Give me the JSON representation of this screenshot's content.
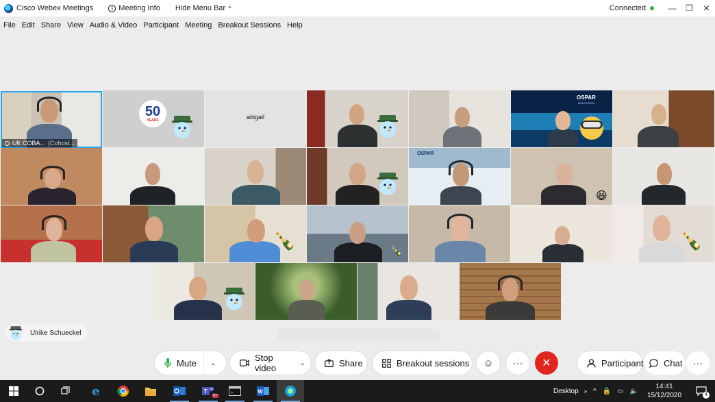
{
  "titlebar": {
    "app_name": "Cisco Webex Meetings",
    "meeting_info": "Meeting Info",
    "hide_menu_bar": "Hide Menu Bar",
    "status": "Connected",
    "status_color": "#2cb34a"
  },
  "menubar": {
    "items": [
      "File",
      "Edit",
      "Share",
      "View",
      "Audio & Video",
      "Participant",
      "Meeting",
      "Breakout Sessions",
      "Help"
    ]
  },
  "grid": {
    "active_tile_name": "UK COBA...",
    "active_tile_role": "(Cohost...",
    "abigail_label": "abigail",
    "logo_50": "50",
    "logo_50_sub": "YEARS",
    "ospar_label": "OSPAR",
    "ospar_sub": "MINISTERIAL"
  },
  "floating": {
    "name": "Ulrike Schueckel"
  },
  "controls": {
    "mute": "Mute",
    "stop_video": "Stop video",
    "share": "Share",
    "breakout": "Breakout sessions",
    "participants": "Participants",
    "chat": "Chat",
    "more": "···",
    "end": "✕"
  },
  "taskbar": {
    "desktop": "Desktop",
    "time": "14:41",
    "date": "15/12/2020",
    "notif_count": "4",
    "teams_badge": "9+"
  },
  "colors": {
    "accent": "#29a6f0",
    "end_call": "#e0271f",
    "mic_green": "#2cb34a"
  }
}
